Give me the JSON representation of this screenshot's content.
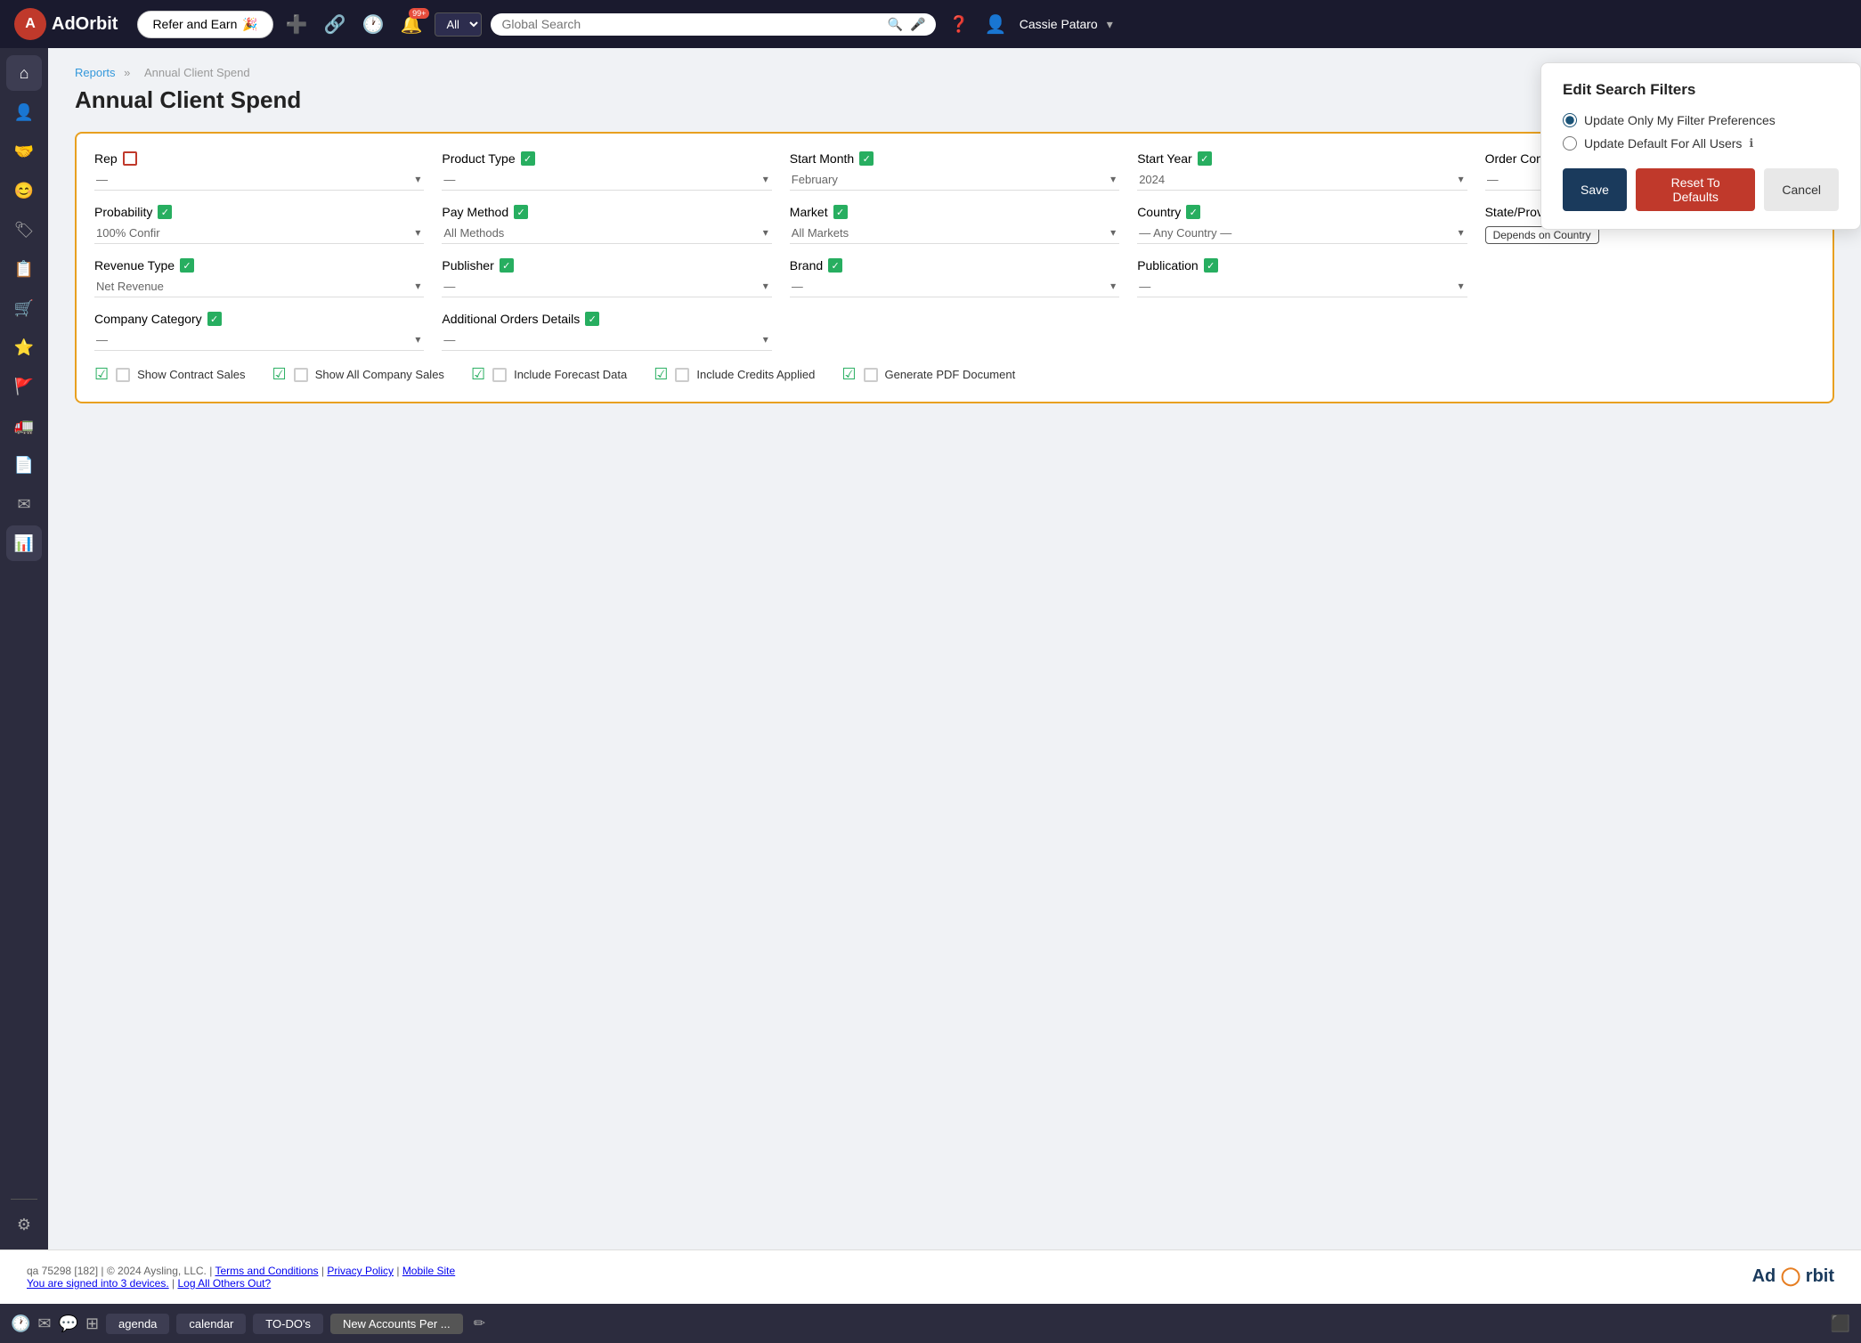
{
  "app": {
    "name": "AdOrbit",
    "logo_letter": "A"
  },
  "navbar": {
    "refer_btn": "Refer and Earn",
    "all_label": "All",
    "search_placeholder": "Global Search",
    "notifications_count": "99+",
    "user_name": "Cassie Pataro"
  },
  "breadcrumb": {
    "parent": "Reports",
    "separator": "»",
    "current": "Annual Client Spend"
  },
  "page": {
    "title": "Annual Client Spend"
  },
  "filters": {
    "rep": {
      "label": "Rep",
      "checked": false,
      "value": "—"
    },
    "product_type": {
      "label": "Product Type",
      "checked": true,
      "value": "—"
    },
    "start_month": {
      "label": "Start Month",
      "checked": true,
      "value": "February"
    },
    "start_year": {
      "label": "Start Year",
      "checked": true,
      "value": "2024"
    },
    "order_company": {
      "label": "Order Company",
      "checked": true,
      "value": "—"
    },
    "probability": {
      "label": "Probability",
      "checked": true,
      "value": "100% Confir"
    },
    "pay_method": {
      "label": "Pay Method",
      "checked": true,
      "value": "All Methods"
    },
    "market": {
      "label": "Market",
      "checked": true,
      "value": "All Markets"
    },
    "country": {
      "label": "Country",
      "checked": true,
      "value": "— Any Country —"
    },
    "state_province_region": {
      "label": "State/Province/Region",
      "checked": true,
      "value": "Depends on Country"
    },
    "revenue_type": {
      "label": "Revenue Type",
      "checked": true,
      "value": "Net Revenue"
    },
    "publisher": {
      "label": "Publisher",
      "checked": true,
      "value": "—"
    },
    "brand": {
      "label": "Brand",
      "checked": true,
      "value": "—"
    },
    "publication": {
      "label": "Publication",
      "checked": true,
      "value": "—"
    },
    "company_category": {
      "label": "Company Category",
      "checked": true,
      "value": "—"
    },
    "additional_orders_details": {
      "label": "Additional Orders Details",
      "checked": true,
      "value": "—"
    }
  },
  "checkboxes": {
    "show_contract_sales": {
      "label": "Show Contract Sales",
      "checked": true
    },
    "show_all_company_sales": {
      "label": "Show All Company Sales",
      "checked": true
    },
    "include_forecast_data": {
      "label": "Include Forecast Data",
      "checked": true
    },
    "include_credits_applied": {
      "label": "Include Credits Applied",
      "checked": true
    },
    "generate_pdf_document": {
      "label": "Generate PDF Document",
      "checked": true
    }
  },
  "popup": {
    "title": "Edit Search Filters",
    "option1": "Update Only My Filter Preferences",
    "option2": "Update Default For All Users",
    "save_btn": "Save",
    "reset_btn": "Reset To Defaults",
    "cancel_btn": "Cancel"
  },
  "footer": {
    "copyright": "qa 75298 [182] | © 2024 Aysling, LLC. |",
    "terms": "Terms and Conditions",
    "privacy": "Privacy Policy",
    "mobile": "Mobile Site",
    "signed_in": "You are signed into 3 devices.",
    "log_others": "Log All Others Out?",
    "logo_text": "AdOrbit"
  },
  "taskbar": {
    "agenda_btn": "agenda",
    "calendar_btn": "calendar",
    "todo_btn": "TO-DO's",
    "new_accounts_btn": "New Accounts Per ..."
  },
  "sidebar_items": [
    {
      "name": "home",
      "icon": "⌂"
    },
    {
      "name": "contacts",
      "icon": "👤"
    },
    {
      "name": "handshake",
      "icon": "🤝"
    },
    {
      "name": "face",
      "icon": "😊"
    },
    {
      "name": "tag",
      "icon": "🏷"
    },
    {
      "name": "orders",
      "icon": "📋"
    },
    {
      "name": "cart",
      "icon": "🛒"
    },
    {
      "name": "star",
      "icon": "⭐"
    },
    {
      "name": "flag",
      "icon": "🚩"
    },
    {
      "name": "truck",
      "icon": "🚛"
    },
    {
      "name": "doc",
      "icon": "📄"
    },
    {
      "name": "mail",
      "icon": "✉"
    },
    {
      "name": "reports",
      "icon": "📊"
    },
    {
      "name": "settings",
      "icon": "⚙"
    }
  ]
}
